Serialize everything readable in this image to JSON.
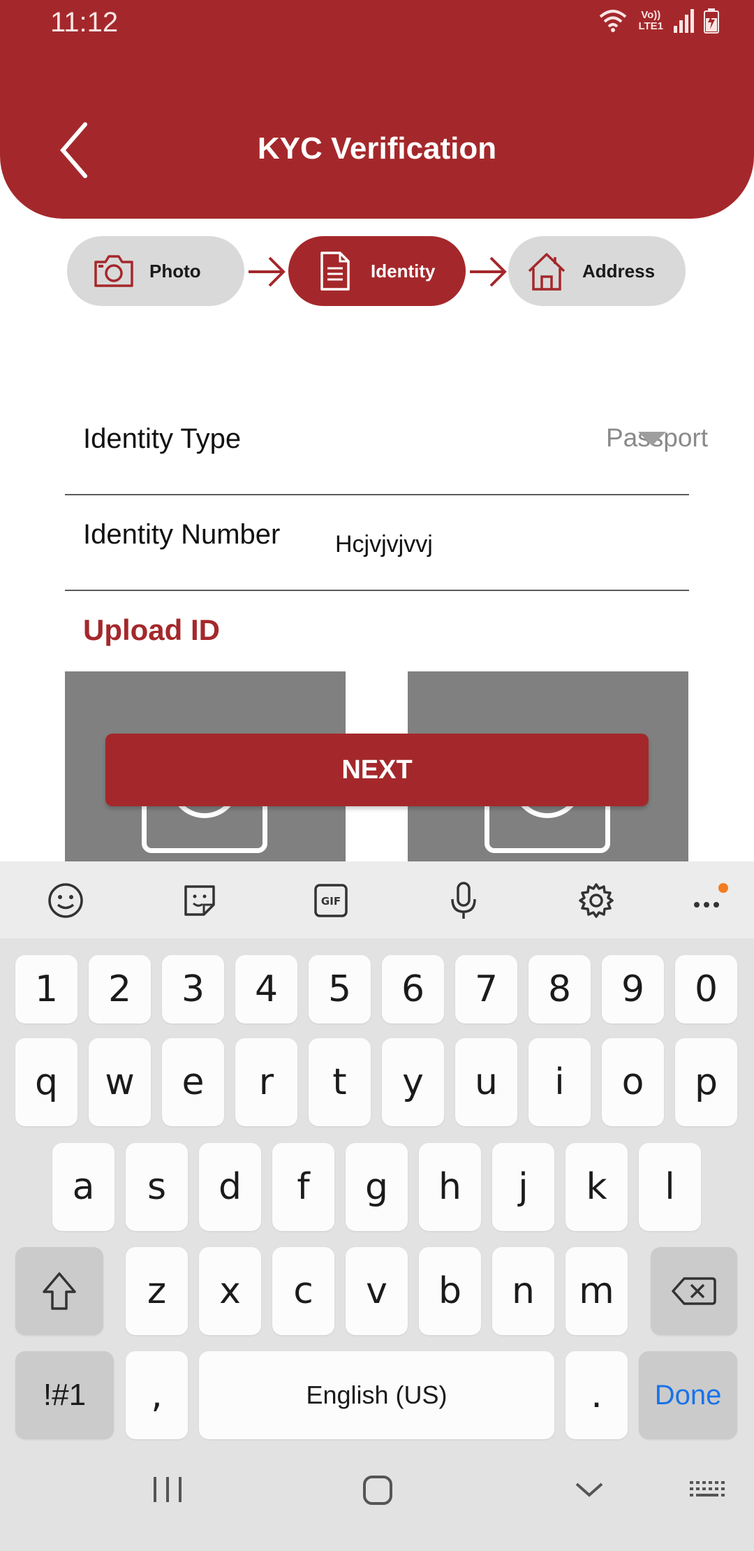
{
  "status_bar": {
    "time": "11:12",
    "lte_top": "Vo))",
    "lte_bottom": "LTE1"
  },
  "header": {
    "title": "KYC Verification"
  },
  "steps": [
    {
      "label": "Photo",
      "icon": "camera-icon",
      "active": false
    },
    {
      "label": "Identity",
      "icon": "document-icon",
      "active": true
    },
    {
      "label": "Address",
      "icon": "home-icon",
      "active": false
    }
  ],
  "form": {
    "identity_type_label": "Identity Type",
    "identity_type_value": "Passport",
    "identity_number_label": "Identity Number",
    "identity_number_value": "Hcjvjvjvvj",
    "upload_title": "Upload ID"
  },
  "next_label": "NEXT",
  "keyboard": {
    "number_row": [
      "1",
      "2",
      "3",
      "4",
      "5",
      "6",
      "7",
      "8",
      "9",
      "0"
    ],
    "row1": [
      "q",
      "w",
      "e",
      "r",
      "t",
      "y",
      "u",
      "i",
      "o",
      "p"
    ],
    "row2": [
      "a",
      "s",
      "d",
      "f",
      "g",
      "h",
      "j",
      "k",
      "l"
    ],
    "row3": [
      "z",
      "x",
      "c",
      "v",
      "b",
      "n",
      "m"
    ],
    "symbols_key": "!#1",
    "comma_key": ",",
    "space_key": "English (US)",
    "period_key": ".",
    "done_key": "Done"
  },
  "colors": {
    "brand": "#a4282b",
    "done": "#1a73e8",
    "cursor": "#12857a"
  }
}
